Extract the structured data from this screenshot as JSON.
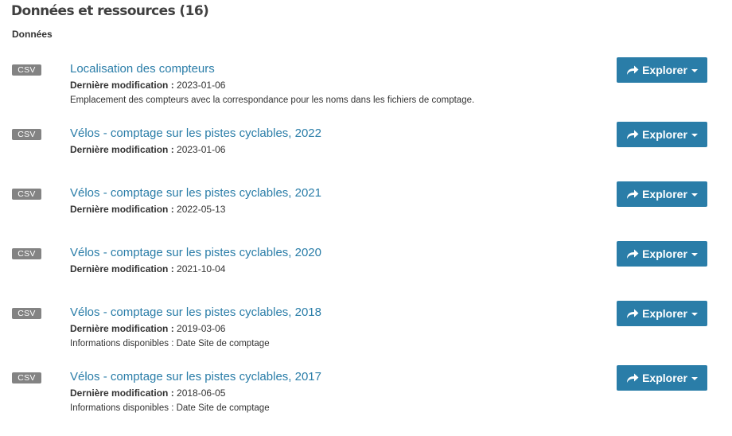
{
  "header": {
    "title": "Données et ressources (16)",
    "section": "Données"
  },
  "resources": [
    {
      "format": "CSV",
      "title": "Localisation des compteurs",
      "modified_label": "Dernière modification :",
      "modified_date": "2023-01-06",
      "description": "Emplacement des compteurs avec la correspondance pour les noms dans les fichiers de comptage.",
      "explore_label": "Explorer"
    },
    {
      "format": "CSV",
      "title": "Vélos - comptage sur les pistes cyclables, 2022",
      "modified_label": "Dernière modification :",
      "modified_date": "2023-01-06",
      "description": "",
      "explore_label": "Explorer"
    },
    {
      "format": "CSV",
      "title": "Vélos - comptage sur les pistes cyclables, 2021",
      "modified_label": "Dernière modification :",
      "modified_date": "2022-05-13",
      "description": "",
      "explore_label": "Explorer"
    },
    {
      "format": "CSV",
      "title": "Vélos - comptage sur les pistes cyclables, 2020",
      "modified_label": "Dernière modification :",
      "modified_date": "2021-10-04",
      "description": "",
      "explore_label": "Explorer"
    },
    {
      "format": "CSV",
      "title": "Vélos - comptage sur les pistes cyclables, 2018",
      "modified_label": "Dernière modification :",
      "modified_date": "2019-03-06",
      "description": "Informations disponibles : Date Site de comptage",
      "explore_label": "Explorer"
    },
    {
      "format": "CSV",
      "title": "Vélos - comptage sur les pistes cyclables, 2017",
      "modified_label": "Dernière modification :",
      "modified_date": "2018-06-05",
      "description": "Informations disponibles : Date Site de comptage",
      "explore_label": "Explorer"
    }
  ],
  "colors": {
    "accent": "#2a7da8",
    "badge": "#838383",
    "text": "#333333"
  },
  "icons": {
    "explore": "share-icon",
    "dropdown": "caret-down-icon"
  }
}
